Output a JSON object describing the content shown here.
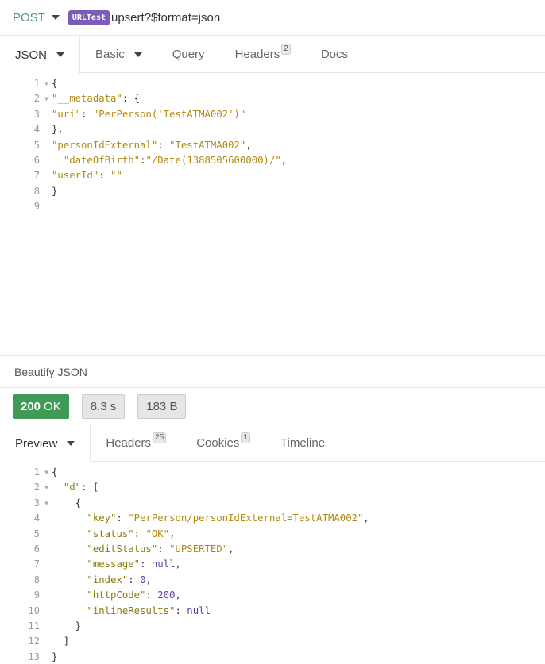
{
  "urlbar": {
    "method": "POST",
    "env_tag": "URLTest",
    "url": "upsert?$format=json"
  },
  "request_tabs": [
    {
      "label": "JSON",
      "active": true,
      "dropdown": true
    },
    {
      "label": "Basic",
      "dropdown": true
    },
    {
      "label": "Query"
    },
    {
      "label": "Headers",
      "badge": "2"
    },
    {
      "label": "Docs"
    }
  ],
  "request_body": [
    {
      "n": "1",
      "fold": true,
      "text": "{"
    },
    {
      "n": "2",
      "fold": true,
      "text": "\"__metadata\": {"
    },
    {
      "n": "3",
      "text": "\"uri\": \"PerPerson('TestATMA002')\""
    },
    {
      "n": "4",
      "text": "},"
    },
    {
      "n": "5",
      "text": "\"personIdExternal\": \"TestATMA002\","
    },
    {
      "n": "6",
      "text": "  \"dateOfBirth\":\"/Date(1388505600000)/\","
    },
    {
      "n": "7",
      "text": "\"userId\": \"\""
    },
    {
      "n": "8",
      "text": "}"
    },
    {
      "n": "9",
      "text": ""
    }
  ],
  "beautify_label": "Beautify JSON",
  "status": {
    "code": "200",
    "text": "OK",
    "time": "8.3 s",
    "size": "183 B",
    "ok_color": "#3f9a55"
  },
  "response_tabs": [
    {
      "label": "Preview",
      "active": true,
      "dropdown": true
    },
    {
      "label": "Headers",
      "badge": "25"
    },
    {
      "label": "Cookies",
      "badge": "1"
    },
    {
      "label": "Timeline"
    }
  ],
  "response_body": [
    {
      "n": "1",
      "fold": true,
      "text": "{"
    },
    {
      "n": "2",
      "fold": true,
      "text": "  \"d\": ["
    },
    {
      "n": "3",
      "fold": true,
      "text": "    {"
    },
    {
      "n": "4",
      "text": "      \"key\": \"PerPerson/personIdExternal=TestATMA002\","
    },
    {
      "n": "5",
      "text": "      \"status\": \"OK\","
    },
    {
      "n": "6",
      "text": "      \"editStatus\": \"UPSERTED\","
    },
    {
      "n": "7",
      "text": "      \"message\": null,"
    },
    {
      "n": "8",
      "text": "      \"index\": 0,"
    },
    {
      "n": "9",
      "text": "      \"httpCode\": 200,"
    },
    {
      "n": "10",
      "text": "      \"inlineResults\": null"
    },
    {
      "n": "11",
      "text": "    }"
    },
    {
      "n": "12",
      "text": "  ]"
    },
    {
      "n": "13",
      "text": "}"
    }
  ],
  "colors": {
    "key": "#8a7a10",
    "string": "#b08a12",
    "literal": "#5b3aa8",
    "env_tag": "#7b5cb8"
  }
}
